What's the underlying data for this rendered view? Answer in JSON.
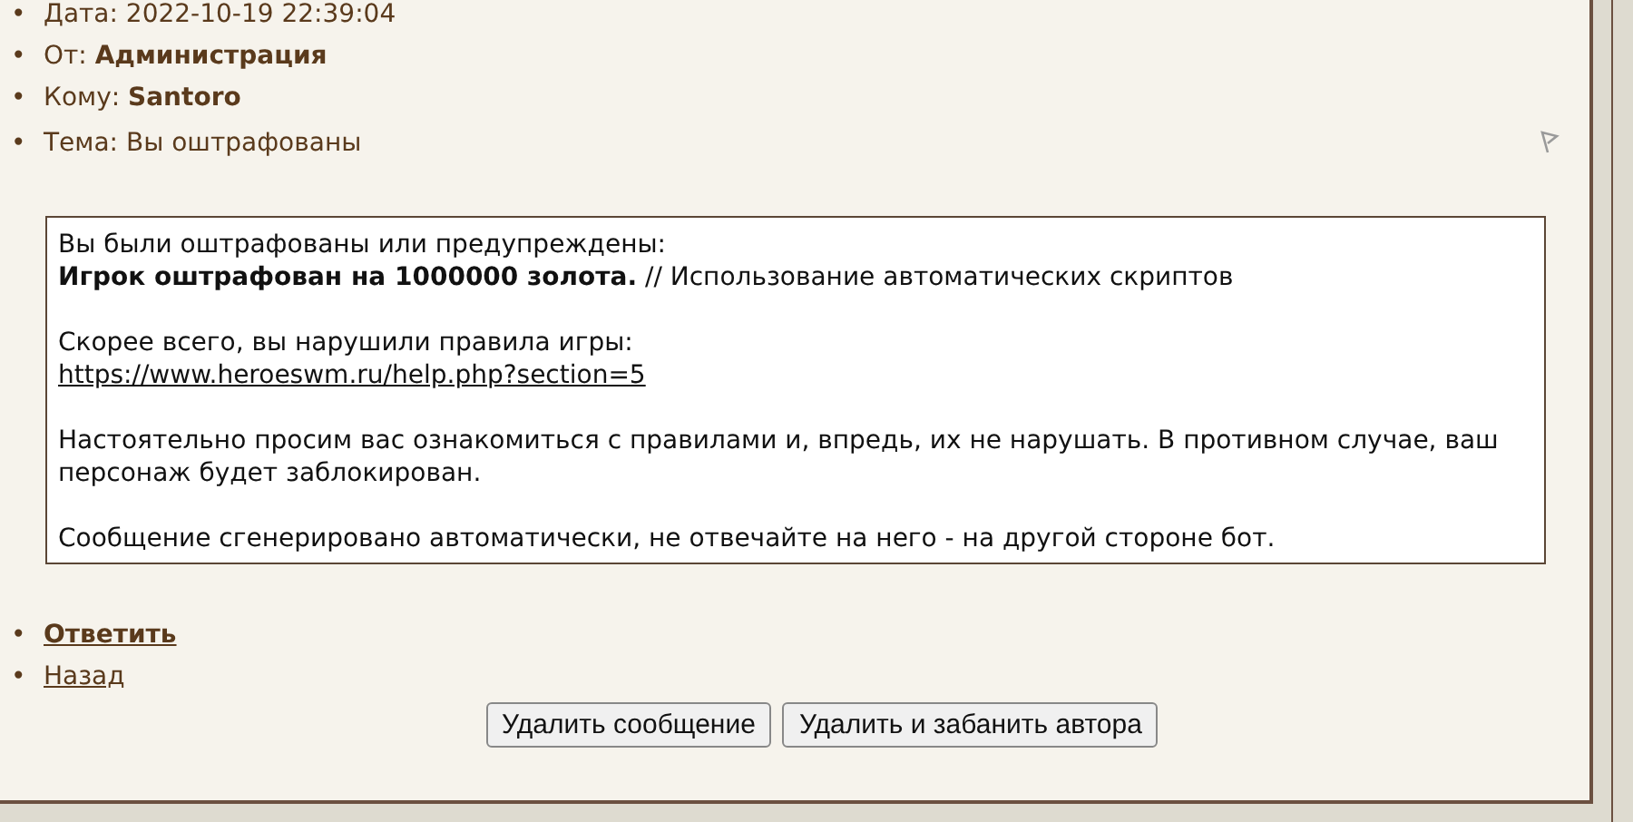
{
  "header": [
    {
      "marker": "•",
      "text": "Дата: 2022-10-19 22:39:04"
    },
    {
      "marker": "•",
      "text": "От: **Администрация**"
    },
    {
      "marker": "•",
      "text": "Кому: **Santoro**"
    },
    {
      "marker": "•",
      "text": "Тема: Вы оштрафованы"
    }
  ],
  "message": [
    [
      {
        "kind": "text",
        "text": "Вы были оштрафованы или предупреждены:"
      },
      {
        "kind": "text",
        "text": "**Игрок оштрафован на 1000000 золота.** // Использование автоматических скриптов"
      }
    ],
    [
      {
        "kind": "text",
        "text": "Скорее всего, вы нарушили правила игры:"
      },
      {
        "kind": "link",
        "text": "https://www.heroeswm.ru/help.php?section=5"
      }
    ],
    [
      {
        "kind": "text",
        "text": "Настоятельно просим вас ознакомиться с правилами и, впредь, их не нарушать. В противном случае, ваш персонаж будет заблокирован."
      }
    ],
    [
      {
        "kind": "text",
        "text": "Сообщение сгенерировано автоматически, не отвечайте на него - на другой стороне бот."
      }
    ]
  ],
  "links": [
    {
      "marker": "•",
      "text": "Ответить",
      "bold": true
    },
    {
      "marker": "•",
      "text": "Назад",
      "bold": false
    }
  ],
  "buttons": [
    "Удалить сообщение",
    "Удалить и забанить автора"
  ]
}
